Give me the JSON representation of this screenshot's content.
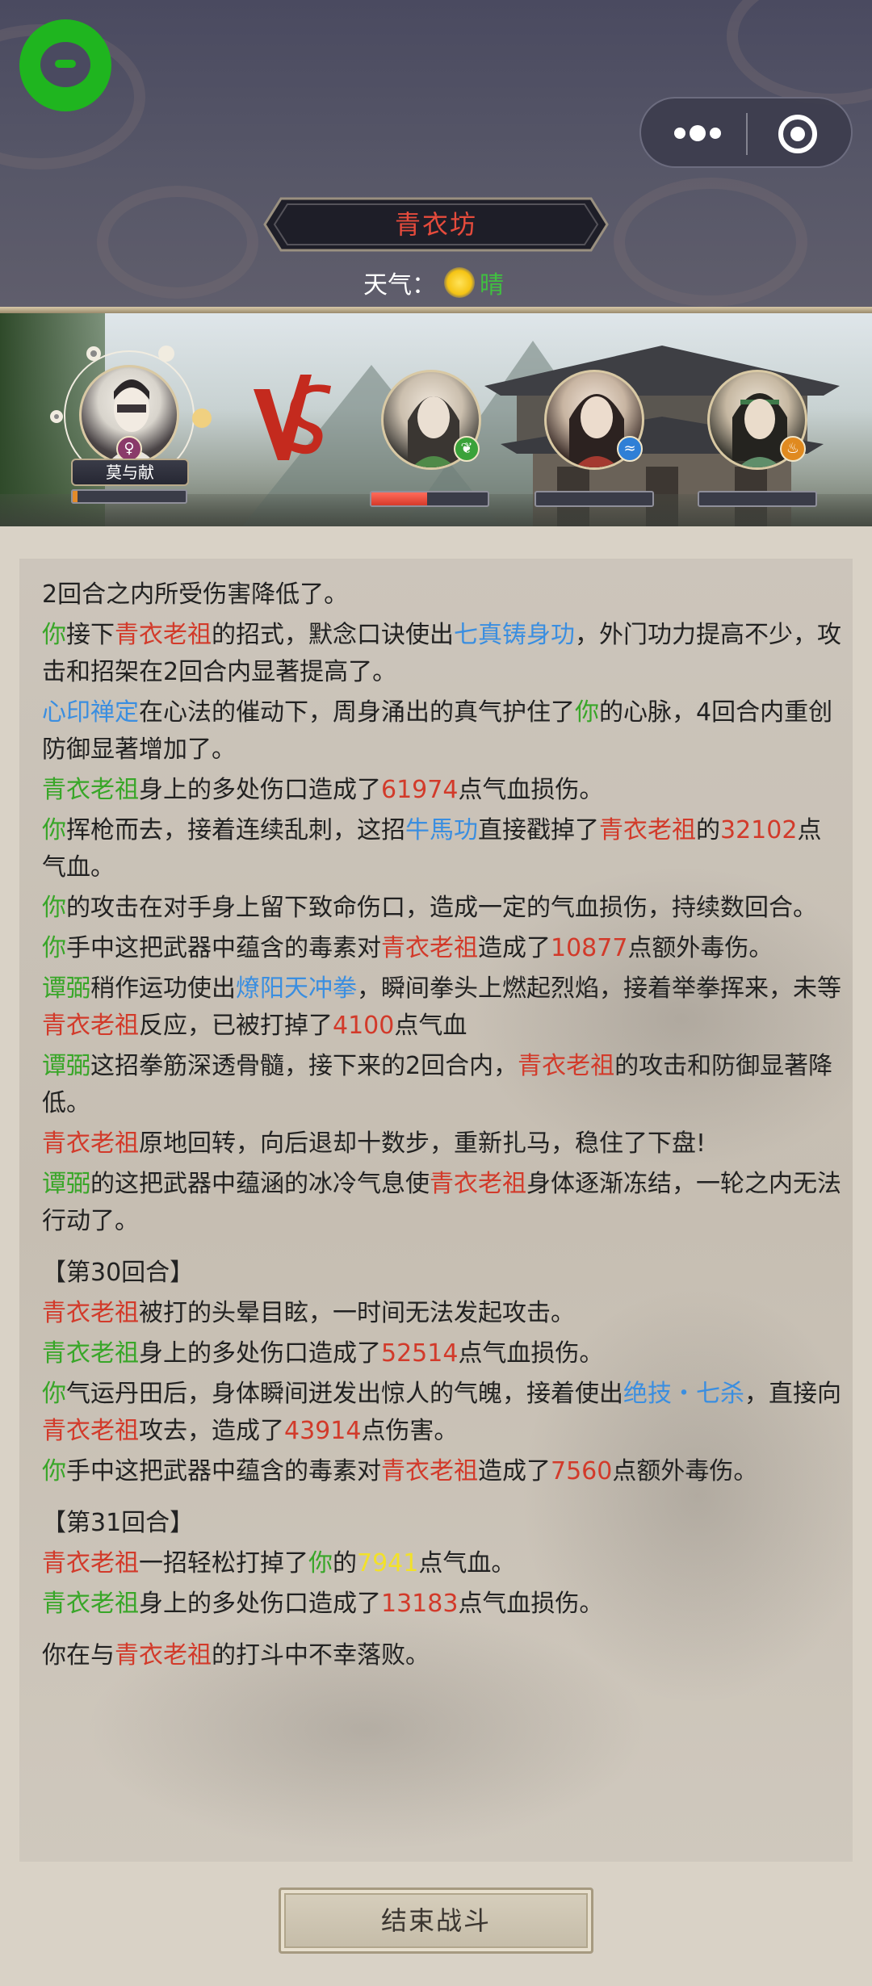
{
  "header": {
    "location": "青衣坊",
    "weather_label": "天气：",
    "weather_value": "晴",
    "weather_icon": "sun-icon"
  },
  "battle": {
    "player": {
      "name": "莫与献",
      "gender_icon": "female-icon",
      "hp_fraction": 0.04
    },
    "enemies": [
      {
        "element_icon": "leaf-icon",
        "element_color": "#3aa23a",
        "hp_fraction": 0.48
      },
      {
        "element_icon": "water-icon",
        "element_color": "#2f7fd6",
        "hp_fraction": 0.0
      },
      {
        "element_icon": "fire-icon",
        "element_color": "#e08a20",
        "hp_fraction": 0.0
      }
    ]
  },
  "log": {
    "l1": [
      "2回合之内所受伤害降低了。"
    ],
    "l2": [
      "你",
      "接下",
      "青衣老祖",
      "的招式，默念口诀使出",
      "七真铸身功",
      "，外门功力提高不少，攻击和招架在2回合内显著提高了。"
    ],
    "l3": [
      "心印禅定",
      "在心法的催动下，周身涌出的真气护住了",
      "你",
      "的心脉，4回合内重创防御显著增加了。"
    ],
    "l4": [
      "青衣老祖",
      "身上的多处伤口造成了",
      "61974",
      "点气血损伤。"
    ],
    "l5": [
      "你",
      "挥枪而去，接着连续乱刺，这招",
      "牛馬功",
      "直接戳掉了",
      "青衣老祖",
      "的",
      "32102",
      "点气血。"
    ],
    "l6": [
      "你",
      "的攻击在对手身上留下致命伤口，造成一定的气血损伤，持续数回合。"
    ],
    "l7": [
      "你",
      "手中这把武器中蕴含的毒素对",
      "青衣老祖",
      "造成了",
      "10877",
      "点额外毒伤。"
    ],
    "l8": [
      "谭弼",
      "稍作运功使出",
      "燎阳天冲拳",
      "，瞬间拳头上燃起烈焰，接着举拳挥来，未等",
      "青衣老祖",
      "反应，已被打掉了",
      "4100",
      "点气血"
    ],
    "l9": [
      "谭弼",
      "这招拳筋深透骨髓，接下来的2回合内，",
      "青衣老祖",
      "的攻击和防御显著降低。"
    ],
    "l10": [
      "青衣老祖",
      "原地回转，向后退却十数步，重新扎马，稳住了下盘!"
    ],
    "l11": [
      "谭弼",
      "的这把武器中蕴涵的冰冷气息使",
      "青衣老祖",
      "身体逐渐冻结，一轮之内无法行动了。"
    ],
    "round30": "【第30回合】",
    "l12": [
      "青衣老祖",
      "被打的头晕目眩，一时间无法发起攻击。"
    ],
    "l13": [
      "青衣老祖",
      "身上的多处伤口造成了",
      "52514",
      "点气血损伤。"
    ],
    "l14": [
      "你",
      "气运丹田后，身体瞬间迸发出惊人的气魄，接着使出",
      "绝技・七杀",
      "，直接向",
      "青衣老祖",
      "攻去，造成了",
      "43914",
      "点伤害。"
    ],
    "l15": [
      "你",
      "手中这把武器中蕴含的毒素对",
      "青衣老祖",
      "造成了",
      "7560",
      "点额外毒伤。"
    ],
    "round31": "【第31回合】",
    "l16": [
      "青衣老祖",
      "一招轻松打掉了",
      "你",
      "的",
      "7941",
      "点气血。"
    ],
    "l17": [
      "青衣老祖",
      "身上的多处伤口造成了",
      "13183",
      "点气血损伤。"
    ],
    "l18": [
      "你在与",
      "青衣老祖",
      "的打斗中不幸落败。"
    ]
  },
  "footer": {
    "end_button": "结束战斗"
  },
  "colors": {
    "ally": "#38a628",
    "enemy": "#d23a2a",
    "skill": "#3a8ee0",
    "damage_taken": "#f2e12a"
  }
}
